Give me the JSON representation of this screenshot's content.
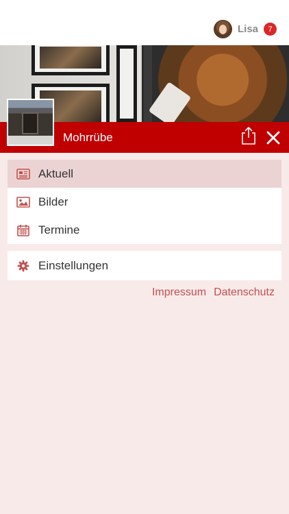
{
  "header": {
    "user_name": "Lisa",
    "notification_count": "7",
    "avatar_icon": "user-avatar"
  },
  "profile": {
    "title": "Mohrrübe",
    "share_icon": "share-icon",
    "close_icon": "close-icon"
  },
  "menu": {
    "items": [
      {
        "label": "Aktuell",
        "icon": "newspaper-icon",
        "active": true
      },
      {
        "label": "Bilder",
        "icon": "image-icon",
        "active": false
      },
      {
        "label": "Termine",
        "icon": "calendar-icon",
        "active": false
      }
    ],
    "settings": {
      "label": "Einstellungen",
      "icon": "gear-icon"
    }
  },
  "footer": {
    "impressum": "Impressum",
    "datenschutz": "Datenschutz"
  },
  "colors": {
    "brand_red": "#c00000",
    "badge_red": "#d82828",
    "icon_red": "#c0504d",
    "active_bg": "#ecd3d3",
    "page_bg": "#f9eaea"
  }
}
